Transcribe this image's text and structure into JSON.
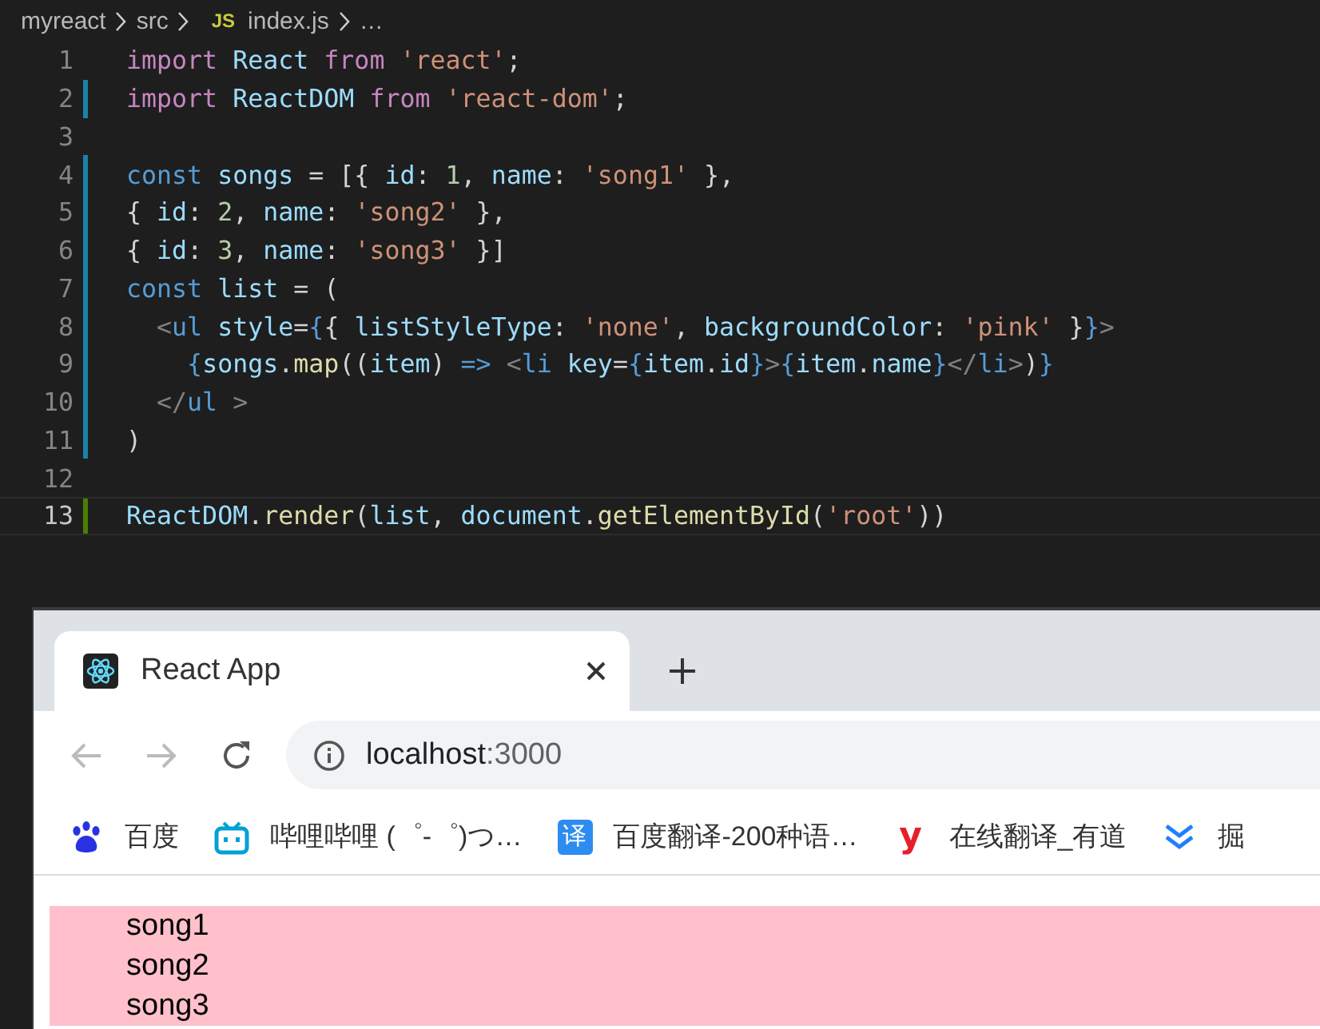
{
  "editor": {
    "breadcrumb": [
      {
        "kind": "folder",
        "text": "myreact"
      },
      {
        "kind": "folder",
        "text": "src"
      },
      {
        "kind": "file",
        "icon_text": "JS",
        "text": "index.js"
      },
      {
        "kind": "more",
        "text": "…"
      }
    ],
    "lines": [
      {
        "number": "1",
        "modified": false,
        "added": false,
        "current": false,
        "tokens": [
          {
            "kind": "keyword",
            "text": "import "
          },
          {
            "kind": "variable",
            "text": "React "
          },
          {
            "kind": "keyword",
            "text": "from "
          },
          {
            "kind": "string",
            "text": "'react'"
          },
          {
            "kind": "plain",
            "text": ";"
          }
        ]
      },
      {
        "number": "2",
        "modified": true,
        "added": false,
        "current": false,
        "tokens": [
          {
            "kind": "keyword",
            "text": "import "
          },
          {
            "kind": "variable",
            "text": "ReactDOM "
          },
          {
            "kind": "keyword",
            "text": "from "
          },
          {
            "kind": "string",
            "text": "'react-dom'"
          },
          {
            "kind": "plain",
            "text": ";"
          }
        ]
      },
      {
        "number": "3",
        "modified": false,
        "added": false,
        "current": false
      },
      {
        "number": "4",
        "modified": true,
        "added": false,
        "current": false,
        "tokens": [
          {
            "kind": "storage",
            "text": "const "
          },
          {
            "kind": "variable",
            "text": "songs"
          },
          {
            "kind": "plain",
            "text": " = [{ "
          },
          {
            "kind": "variable",
            "text": "id"
          },
          {
            "kind": "plain",
            "text": ": "
          },
          {
            "kind": "number",
            "text": "1"
          },
          {
            "kind": "plain",
            "text": ", "
          },
          {
            "kind": "variable",
            "text": "name"
          },
          {
            "kind": "plain",
            "text": ": "
          },
          {
            "kind": "string",
            "text": "'song1'"
          },
          {
            "kind": "plain",
            "text": " },"
          }
        ]
      },
      {
        "number": "5",
        "modified": true,
        "added": false,
        "current": false,
        "tokens": [
          {
            "kind": "plain",
            "text": "{ "
          },
          {
            "kind": "variable",
            "text": "id"
          },
          {
            "kind": "plain",
            "text": ": "
          },
          {
            "kind": "number",
            "text": "2"
          },
          {
            "kind": "plain",
            "text": ", "
          },
          {
            "kind": "variable",
            "text": "name"
          },
          {
            "kind": "plain",
            "text": ": "
          },
          {
            "kind": "string",
            "text": "'song2'"
          },
          {
            "kind": "plain",
            "text": " },"
          }
        ]
      },
      {
        "number": "6",
        "modified": true,
        "added": false,
        "current": false,
        "tokens": [
          {
            "kind": "plain",
            "text": "{ "
          },
          {
            "kind": "variable",
            "text": "id"
          },
          {
            "kind": "plain",
            "text": ": "
          },
          {
            "kind": "number",
            "text": "3"
          },
          {
            "kind": "plain",
            "text": ", "
          },
          {
            "kind": "variable",
            "text": "name"
          },
          {
            "kind": "plain",
            "text": ": "
          },
          {
            "kind": "string",
            "text": "'song3'"
          },
          {
            "kind": "plain",
            "text": " }]"
          }
        ]
      },
      {
        "number": "7",
        "modified": true,
        "added": false,
        "current": false,
        "tokens": [
          {
            "kind": "storage",
            "text": "const "
          },
          {
            "kind": "variable",
            "text": "list"
          },
          {
            "kind": "plain",
            "text": " = ("
          }
        ]
      },
      {
        "number": "8",
        "modified": true,
        "added": false,
        "current": false,
        "tokens": [
          {
            "kind": "tag-punct",
            "text": "  <"
          },
          {
            "kind": "tag",
            "text": "ul "
          },
          {
            "kind": "variable",
            "text": "style"
          },
          {
            "kind": "plain",
            "text": "="
          },
          {
            "kind": "brace",
            "text": "{"
          },
          {
            "kind": "plain",
            "text": "{ "
          },
          {
            "kind": "variable",
            "text": "listStyleType"
          },
          {
            "kind": "plain",
            "text": ": "
          },
          {
            "kind": "string",
            "text": "'none'"
          },
          {
            "kind": "plain",
            "text": ", "
          },
          {
            "kind": "variable",
            "text": "backgroundColor"
          },
          {
            "kind": "plain",
            "text": ": "
          },
          {
            "kind": "string",
            "text": "'pink'"
          },
          {
            "kind": "plain",
            "text": " }"
          },
          {
            "kind": "brace",
            "text": "}"
          },
          {
            "kind": "tag-punct",
            "text": ">"
          }
        ]
      },
      {
        "number": "9",
        "modified": true,
        "added": false,
        "current": false,
        "tokens": [
          {
            "kind": "brace",
            "text": "    {"
          },
          {
            "kind": "variable",
            "text": "songs"
          },
          {
            "kind": "plain",
            "text": "."
          },
          {
            "kind": "function",
            "text": "map"
          },
          {
            "kind": "plain",
            "text": "(("
          },
          {
            "kind": "variable",
            "text": "item"
          },
          {
            "kind": "plain",
            "text": ") "
          },
          {
            "kind": "storage",
            "text": "=> "
          },
          {
            "kind": "tag-punct",
            "text": "<"
          },
          {
            "kind": "tag",
            "text": "li "
          },
          {
            "kind": "variable",
            "text": "key"
          },
          {
            "kind": "plain",
            "text": "="
          },
          {
            "kind": "brace",
            "text": "{"
          },
          {
            "kind": "variable",
            "text": "item"
          },
          {
            "kind": "plain",
            "text": "."
          },
          {
            "kind": "variable",
            "text": "id"
          },
          {
            "kind": "brace",
            "text": "}"
          },
          {
            "kind": "tag-punct",
            "text": ">"
          },
          {
            "kind": "brace",
            "text": "{"
          },
          {
            "kind": "variable",
            "text": "item"
          },
          {
            "kind": "plain",
            "text": "."
          },
          {
            "kind": "variable",
            "text": "name"
          },
          {
            "kind": "brace",
            "text": "}"
          },
          {
            "kind": "tag-punct",
            "text": "</"
          },
          {
            "kind": "tag",
            "text": "li"
          },
          {
            "kind": "tag-punct",
            "text": ">"
          },
          {
            "kind": "plain",
            "text": ")"
          },
          {
            "kind": "brace",
            "text": "}"
          }
        ]
      },
      {
        "number": "10",
        "modified": true,
        "added": false,
        "current": false,
        "tokens": [
          {
            "kind": "tag-punct",
            "text": "  </"
          },
          {
            "kind": "tag",
            "text": "ul "
          },
          {
            "kind": "tag-punct",
            "text": ">"
          }
        ]
      },
      {
        "number": "11",
        "modified": true,
        "added": false,
        "current": false,
        "tokens": [
          {
            "kind": "plain",
            "text": ")"
          }
        ]
      },
      {
        "number": "12",
        "modified": false,
        "added": false,
        "current": false
      },
      {
        "number": "13",
        "modified": false,
        "added": true,
        "current": true,
        "tokens": [
          {
            "kind": "variable",
            "text": "ReactDOM"
          },
          {
            "kind": "plain",
            "text": "."
          },
          {
            "kind": "function",
            "text": "render"
          },
          {
            "kind": "plain",
            "text": "("
          },
          {
            "kind": "variable",
            "text": "list"
          },
          {
            "kind": "plain",
            "text": ", "
          },
          {
            "kind": "variable",
            "text": "document"
          },
          {
            "kind": "plain",
            "text": "."
          },
          {
            "kind": "function",
            "text": "getElementById"
          },
          {
            "kind": "plain",
            "text": "("
          },
          {
            "kind": "string",
            "text": "'root'"
          },
          {
            "kind": "plain",
            "text": "))"
          }
        ]
      }
    ]
  },
  "browser": {
    "tabs": [
      {
        "title": "React App",
        "selected": true
      }
    ],
    "nav": {
      "back_disabled": true,
      "forward_disabled": true
    },
    "address": {
      "host": "localhost",
      "port": ":3000"
    },
    "bookmarks": [
      {
        "kind": "paw",
        "text": "百度"
      },
      {
        "kind": "tv",
        "text": "哔哩哔哩 (゜-゜)つ…"
      },
      {
        "kind": "badge",
        "icon_text": "译",
        "text": "百度翻译-200种语…"
      },
      {
        "kind": "letter",
        "icon_text": "y",
        "text": "在线翻译_有道"
      },
      {
        "kind": "chevrons",
        "text": "掘"
      }
    ],
    "page": {
      "items": [
        "song1",
        "song2",
        "song3"
      ]
    }
  }
}
